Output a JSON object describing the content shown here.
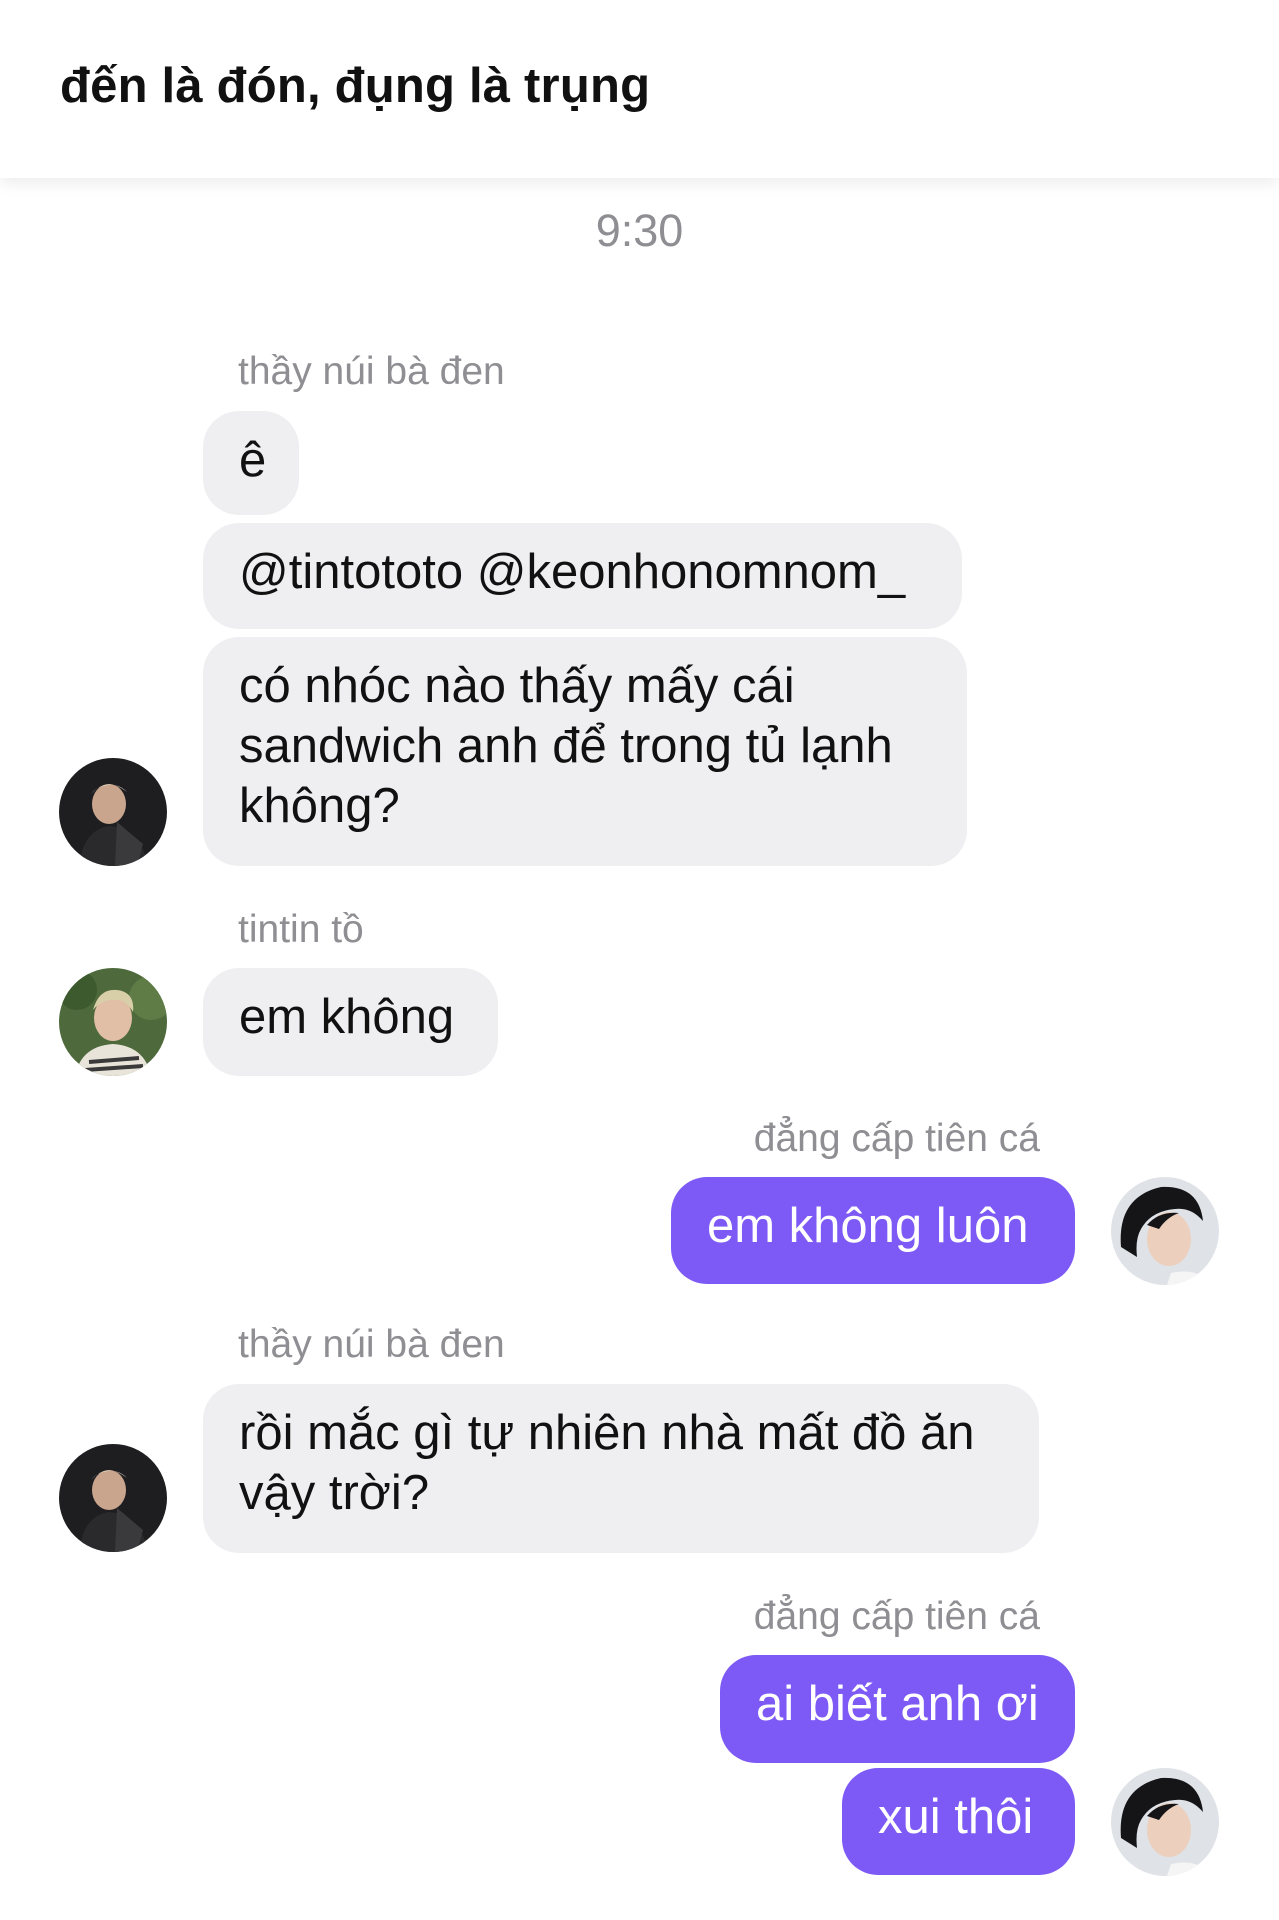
{
  "header": {
    "title": "đến là đón, đụng là trụng"
  },
  "timestamp": "9:30",
  "senders": {
    "s1": "thầy núi bà đen",
    "s2": "tintin tồ",
    "s3": "đẳng cấp tiên cá",
    "s4": "thầy núi bà đen",
    "s5": "đẳng cấp tiên cá"
  },
  "messages": {
    "m1": "ê",
    "m2": "@tintototo @keonhonomnom_",
    "m3": "có nhóc nào thấy mấy cái sandwich anh để trong tủ lạnh không?",
    "m4": "em không",
    "m5": "em không luôn",
    "m6": "rồi mắc gì tự nhiên nhà mất đồ ăn vậy trời?",
    "m7": "ai biết anh ơi",
    "m8": "xui thôi"
  },
  "colors": {
    "incoming_bubble": "#efeff1",
    "outgoing_bubble": "#7d5af5",
    "secondary_text": "#8e8e93"
  }
}
